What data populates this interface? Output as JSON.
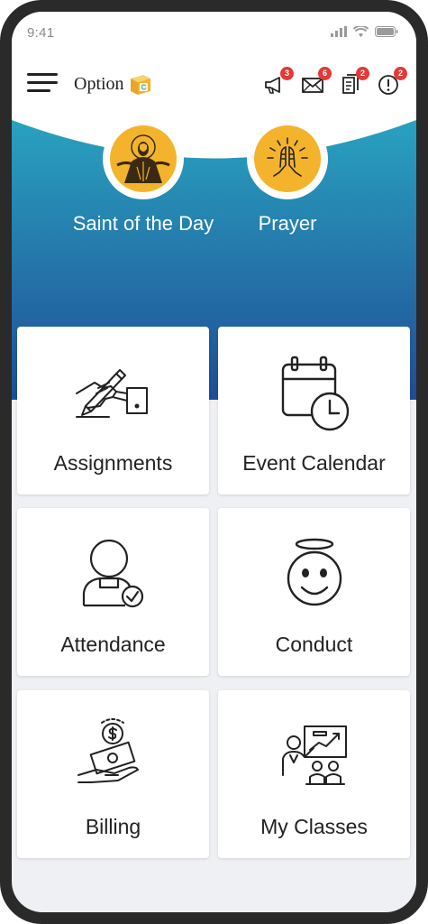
{
  "status_bar": {
    "time": "9:41"
  },
  "header": {
    "brand": "Option",
    "brand_mark": "C",
    "icons": [
      {
        "name": "megaphone-icon",
        "badge": "3"
      },
      {
        "name": "mail-icon",
        "badge": "6"
      },
      {
        "name": "documents-icon",
        "badge": "2"
      },
      {
        "name": "alert-icon",
        "badge": "2"
      }
    ]
  },
  "hero": {
    "items": [
      {
        "label": "Saint of the Day",
        "icon": "saint-icon"
      },
      {
        "label": "Prayer",
        "icon": "praying-hands-icon"
      }
    ]
  },
  "tiles": [
    {
      "label": "Assignments",
      "icon": "writing-hand-icon"
    },
    {
      "label": "Event Calendar",
      "icon": "calendar-clock-icon"
    },
    {
      "label": "Attendance",
      "icon": "person-check-icon"
    },
    {
      "label": "Conduct",
      "icon": "angel-face-icon"
    },
    {
      "label": "Billing",
      "icon": "hand-money-icon"
    },
    {
      "label": "My Classes",
      "icon": "classroom-icon"
    }
  ],
  "colors": {
    "hero_gradient_top": "#2aa7c2",
    "hero_gradient_bottom": "#1f4d96",
    "accent_yellow": "#f4b32c",
    "badge_red": "#e53935"
  }
}
